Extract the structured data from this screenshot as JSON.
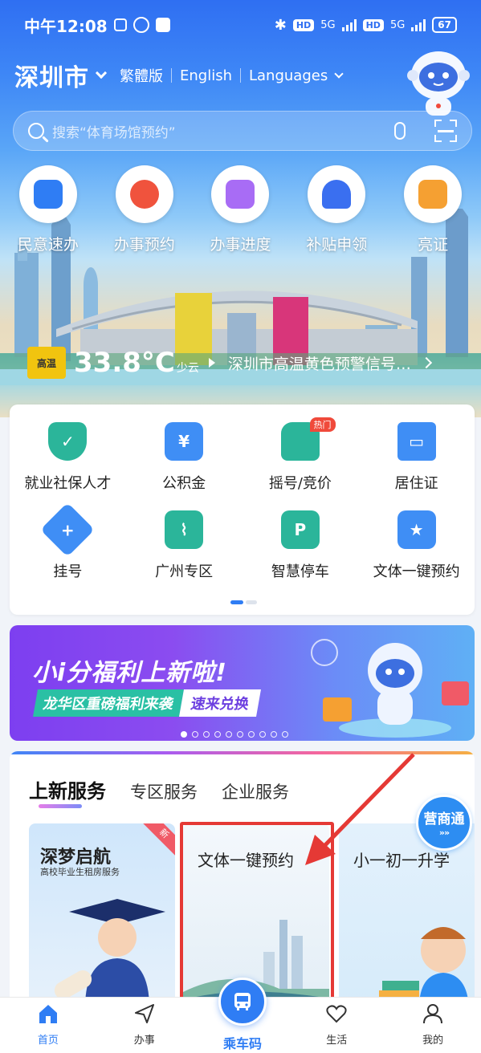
{
  "status_bar": {
    "time": "中午12:08",
    "network_1": "5G",
    "network_2": "5G",
    "hd": "HD",
    "battery": "67"
  },
  "location": {
    "city": "深圳市",
    "traditional": "繁體版",
    "english": "English",
    "languages": "Languages"
  },
  "search": {
    "placeholder": "搜索“体育场馆预约”"
  },
  "quick_actions": [
    {
      "label": "民意速办",
      "icon": "speech-bubble-icon",
      "color": "#2f7df4"
    },
    {
      "label": "办事预约",
      "icon": "clock-icon",
      "color": "#f0533d"
    },
    {
      "label": "办事进度",
      "icon": "progress-arrow-icon",
      "color": "#a86cf5"
    },
    {
      "label": "补贴申领",
      "icon": "train-icon",
      "color": "#3a6ff0"
    },
    {
      "label": "亮证",
      "icon": "wallet-icon",
      "color": "#f5a032"
    }
  ],
  "weather": {
    "badge": "高温",
    "temperature": "33.8°C",
    "condition": "少云",
    "warning": "深圳市高温黄色预警信号…"
  },
  "services": [
    {
      "label": "就业社保人才",
      "icon": "shield-check-icon",
      "color": "#2bb59a"
    },
    {
      "label": "公积金",
      "icon": "house-yuan-icon",
      "color": "#3f8ef5"
    },
    {
      "label": "摇号/竞价",
      "icon": "car-icon",
      "color": "#2bb59a",
      "hot": "热门"
    },
    {
      "label": "居住证",
      "icon": "id-card-icon",
      "color": "#3f8ef5"
    },
    {
      "label": "挂号",
      "icon": "medical-cross-icon",
      "color": "#3f8ef5"
    },
    {
      "label": "广州专区",
      "icon": "guangzhou-tower-icon",
      "color": "#2bb59a"
    },
    {
      "label": "智慧停车",
      "icon": "parking-icon",
      "color": "#2bb59a"
    },
    {
      "label": "文体一键预约",
      "icon": "star-badge-icon",
      "color": "#3f8ef5"
    }
  ],
  "banner": {
    "title": "小i分福利上新啦!",
    "subtitle_a": "龙华区重磅福利来袭",
    "subtitle_b": "速来兑换"
  },
  "new_services": {
    "tabs": [
      "上新服务",
      "专区服务",
      "企业服务"
    ],
    "badge": "营商通",
    "cards": [
      {
        "title": "深梦启航",
        "subtitle": "高校毕业生租房服务",
        "tag": "新"
      },
      {
        "title": "文体一键预约"
      },
      {
        "title": "小一初一升学"
      }
    ]
  },
  "bottom_nav": [
    {
      "label": "首页",
      "icon": "home-icon"
    },
    {
      "label": "办事",
      "icon": "send-icon"
    },
    {
      "label": "乘车码",
      "icon": "bus-icon"
    },
    {
      "label": "生活",
      "icon": "heart-icon"
    },
    {
      "label": "我的",
      "icon": "profile-icon"
    }
  ]
}
